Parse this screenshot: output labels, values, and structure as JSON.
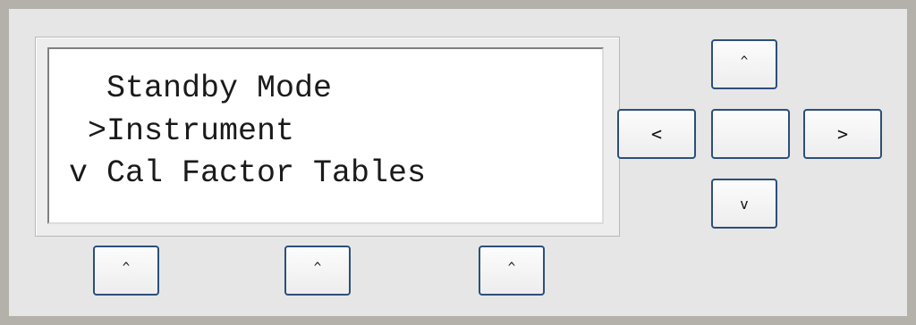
{
  "lcd": {
    "lines": [
      "  Standby Mode",
      " >Instrument",
      "v Cal Factor Tables",
      ""
    ]
  },
  "softkeys": [
    {
      "label": "^"
    },
    {
      "label": "^"
    },
    {
      "label": "^"
    }
  ],
  "nav": {
    "up": "^",
    "left": "<",
    "center": "",
    "right": ">",
    "down": "v"
  },
  "colors": {
    "background": "#b4b0aa",
    "panel": "#e6e6e6",
    "button_border": "#2b4f7a",
    "lcd_background": "#ffffff"
  }
}
